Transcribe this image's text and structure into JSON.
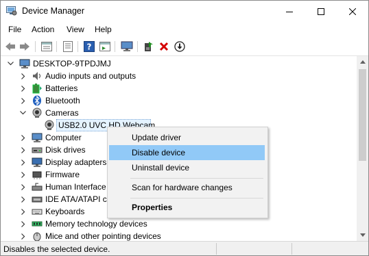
{
  "window": {
    "title": "Device Manager"
  },
  "menu": [
    "File",
    "Action",
    "View",
    "Help"
  ],
  "toolbar_icons": [
    "back-arrow-icon",
    "forward-arrow-icon",
    "properties-icon",
    "list-icon",
    "help-icon",
    "action-panel-icon",
    "monitor-icon",
    "update-driver-icon",
    "uninstall-icon",
    "download-icon"
  ],
  "tree": {
    "root": "DESKTOP-9TPDJMJ",
    "items": [
      {
        "label": "Audio inputs and outputs",
        "icon": "speaker-icon",
        "expanded": false
      },
      {
        "label": "Batteries",
        "icon": "battery-icon",
        "expanded": false
      },
      {
        "label": "Bluetooth",
        "icon": "bluetooth-icon",
        "expanded": false
      },
      {
        "label": "Cameras",
        "icon": "camera-icon",
        "expanded": true
      },
      {
        "label": "USB2.0 UVC HD Webcam",
        "icon": "webcam-icon",
        "child": true,
        "selected": true
      },
      {
        "label": "Computer",
        "icon": "computer-icon",
        "expanded": false
      },
      {
        "label": "Disk drives",
        "icon": "disk-icon",
        "expanded": false
      },
      {
        "label": "Display adapters",
        "icon": "display-icon",
        "expanded": false
      },
      {
        "label": "Firmware",
        "icon": "chip-icon",
        "expanded": false
      },
      {
        "label": "Human Interface Devices",
        "icon": "hid-icon",
        "expanded": false
      },
      {
        "label": "IDE ATA/ATAPI controllers",
        "icon": "ide-icon",
        "expanded": false
      },
      {
        "label": "Keyboards",
        "icon": "keyboard-icon",
        "expanded": false
      },
      {
        "label": "Memory technology devices",
        "icon": "memory-icon",
        "expanded": false
      },
      {
        "label": "Mice and other pointing devices",
        "icon": "mouse-icon",
        "expanded": false
      }
    ]
  },
  "context_menu": {
    "items": [
      {
        "label": "Update driver",
        "bold": false,
        "highlighted": false
      },
      {
        "label": "Disable device",
        "bold": false,
        "highlighted": true
      },
      {
        "label": "Uninstall device",
        "bold": false,
        "highlighted": false
      },
      {
        "label": "Scan for hardware changes",
        "bold": false,
        "highlighted": false
      },
      {
        "label": "Properties",
        "bold": true,
        "highlighted": false
      }
    ]
  },
  "status": {
    "text": "Disables the selected device."
  },
  "colors": {
    "highlight": "#91c9f7",
    "selection": "#e5f3ff",
    "uninstall_red": "#d40000",
    "green_arrow": "#1e8c1e"
  }
}
